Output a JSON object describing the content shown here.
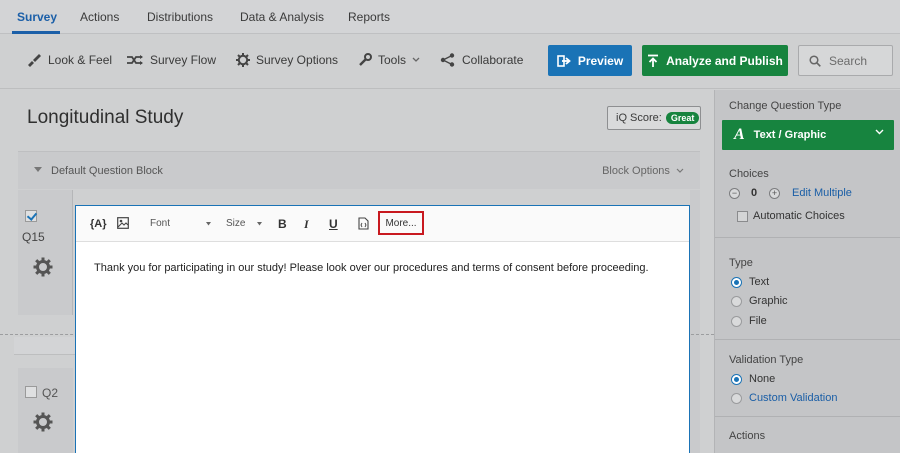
{
  "nav": {
    "tabs": [
      "Survey",
      "Actions",
      "Distributions",
      "Data & Analysis",
      "Reports"
    ],
    "active_tab": "Survey"
  },
  "toolbar": {
    "look_feel": "Look & Feel",
    "survey_flow": "Survey Flow",
    "survey_options": "Survey Options",
    "tools": "Tools",
    "collaborate": "Collaborate",
    "preview": "Preview",
    "analyze_publish": "Analyze and Publish",
    "search_placeholder": "Search"
  },
  "survey": {
    "title": "Longitudinal Study",
    "iq_score_label": "iQ Score:",
    "iq_score_value": "Great",
    "block_name": "Default Question Block",
    "block_options": "Block Options"
  },
  "questions": [
    {
      "id": "Q15",
      "checked": true
    },
    {
      "id": "Q2",
      "checked": false
    }
  ],
  "editor": {
    "piped_text": "{A}",
    "font_label": "Font",
    "size_label": "Size",
    "bold": "B",
    "italic": "I",
    "underline": "U",
    "more": "More...",
    "body": "Thank you for participating in our study! Please look over our procedures and terms of consent before proceeding."
  },
  "panel": {
    "change_type_title": "Change Question Type",
    "current_type": "Text / Graphic",
    "choices_title": "Choices",
    "choices_count": "0",
    "edit_multiple": "Edit Multiple",
    "automatic_choices": "Automatic Choices",
    "type_title": "Type",
    "type_options": [
      "Text",
      "Graphic",
      "File"
    ],
    "type_selected": "Text",
    "validation_title": "Validation Type",
    "validation_options": [
      "None",
      "Custom Validation"
    ],
    "validation_selected": "None",
    "actions_title": "Actions"
  },
  "colors": {
    "brand_blue": "#1a73b6",
    "publish_green": "#17843f",
    "highlight_red": "#c8191f"
  }
}
